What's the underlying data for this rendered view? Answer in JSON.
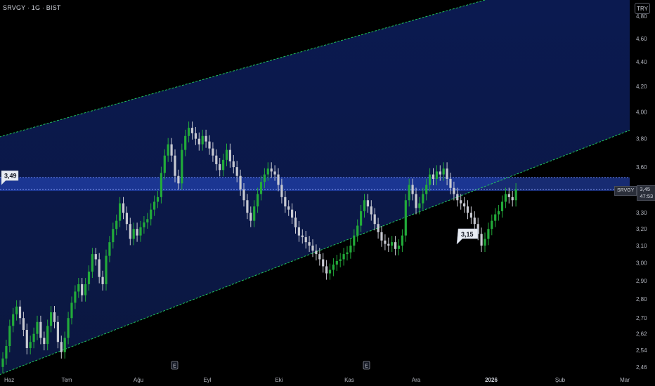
{
  "header": {
    "ticker": "SRVGY · 1G · BIST",
    "currency_button": "TRY"
  },
  "price_tag": {
    "symbol": "SRVGY",
    "price": "3,45",
    "countdown": "47:53"
  },
  "callouts": [
    {
      "label": "3,49",
      "value": 3.49,
      "anchor": "left-edge"
    },
    {
      "label": "3,15",
      "value": 3.15,
      "anchor": "mid-right"
    }
  ],
  "earnings_markers": [
    "E",
    "E"
  ],
  "colors": {
    "up": "#089981",
    "up_bright": "#22ab3a",
    "down": "#c7c9d1",
    "channel_line": "#22c55e",
    "band": "#2a4fd0",
    "background": "#000000"
  },
  "chart_data": {
    "type": "candlestick",
    "title": "",
    "y_scale": "log",
    "ylim": [
      2.43,
      4.95
    ],
    "y_ticks": [
      "4,80",
      "4,60",
      "4,40",
      "4,20",
      "4,00",
      "3,80",
      "3,60",
      "3,30",
      "3,20",
      "3,10",
      "3,00",
      "2,90",
      "2,80",
      "2,70",
      "2,62",
      "2,54",
      "2,46"
    ],
    "y_tick_values": [
      4.8,
      4.6,
      4.4,
      4.2,
      4.0,
      3.8,
      3.6,
      3.3,
      3.2,
      3.1,
      3.0,
      2.9,
      2.8,
      2.7,
      2.62,
      2.54,
      2.46
    ],
    "x_ticks": [
      "Haz",
      "Tem",
      "Ağu",
      "Eyl",
      "Eki",
      "Kas",
      "Ara",
      "2026",
      "Şub",
      "Mar"
    ],
    "grid": false,
    "resistance_band": [
      3.44,
      3.53
    ],
    "last_price": 3.45,
    "channel": {
      "upper": [
        [
          0,
          3.82
        ],
        [
          140,
          4.95
        ]
      ],
      "lower": [
        [
          0,
          2.43
        ],
        [
          140,
          3.47
        ]
      ]
    },
    "closes": [
      2.5,
      2.56,
      2.66,
      2.72,
      2.76,
      2.7,
      2.64,
      2.55,
      2.58,
      2.62,
      2.68,
      2.6,
      2.57,
      2.66,
      2.73,
      2.68,
      2.58,
      2.53,
      2.6,
      2.7,
      2.78,
      2.84,
      2.88,
      2.82,
      2.88,
      2.95,
      3.05,
      3.02,
      2.92,
      2.88,
      3.04,
      3.12,
      3.2,
      3.25,
      3.36,
      3.3,
      3.23,
      3.14,
      3.2,
      3.16,
      3.21,
      3.24,
      3.26,
      3.32,
      3.37,
      3.4,
      3.56,
      3.68,
      3.76,
      3.68,
      3.54,
      3.49,
      3.72,
      3.82,
      3.88,
      3.84,
      3.8,
      3.76,
      3.82,
      3.78,
      3.73,
      3.68,
      3.62,
      3.58,
      3.65,
      3.72,
      3.64,
      3.6,
      3.54,
      3.45,
      3.38,
      3.3,
      3.25,
      3.34,
      3.42,
      3.5,
      3.55,
      3.59,
      3.57,
      3.55,
      3.48,
      3.4,
      3.34,
      3.32,
      3.27,
      3.21,
      3.16,
      3.15,
      3.12,
      3.1,
      3.07,
      3.05,
      3.02,
      2.98,
      2.94,
      2.96,
      2.99,
      3.01,
      3.02,
      3.05,
      3.06,
      3.1,
      3.16,
      3.22,
      3.31,
      3.38,
      3.34,
      3.29,
      3.23,
      3.18,
      3.13,
      3.11,
      3.1,
      3.12,
      3.08,
      3.1,
      3.16,
      3.38,
      3.48,
      3.42,
      3.33,
      3.36,
      3.42,
      3.48,
      3.55,
      3.52,
      3.57,
      3.55,
      3.59,
      3.52,
      3.46,
      3.42,
      3.38,
      3.36,
      3.34,
      3.3,
      3.27,
      3.23,
      3.17,
      3.1,
      3.14,
      3.2,
      3.25,
      3.29,
      3.31,
      3.37,
      3.42,
      3.4,
      3.38,
      3.45
    ],
    "opens": [
      2.46,
      2.5,
      2.56,
      2.66,
      2.72,
      2.76,
      2.7,
      2.64,
      2.55,
      2.58,
      2.62,
      2.68,
      2.6,
      2.57,
      2.66,
      2.73,
      2.68,
      2.58,
      2.53,
      2.6,
      2.7,
      2.78,
      2.84,
      2.88,
      2.82,
      2.88,
      2.95,
      3.05,
      3.02,
      2.92,
      2.88,
      3.04,
      3.12,
      3.2,
      3.25,
      3.36,
      3.3,
      3.23,
      3.14,
      3.2,
      3.16,
      3.21,
      3.24,
      3.26,
      3.32,
      3.37,
      3.4,
      3.56,
      3.68,
      3.76,
      3.68,
      3.54,
      3.49,
      3.72,
      3.82,
      3.88,
      3.84,
      3.8,
      3.76,
      3.82,
      3.78,
      3.73,
      3.68,
      3.62,
      3.58,
      3.65,
      3.72,
      3.64,
      3.6,
      3.54,
      3.45,
      3.38,
      3.3,
      3.25,
      3.34,
      3.42,
      3.5,
      3.55,
      3.59,
      3.57,
      3.55,
      3.48,
      3.4,
      3.34,
      3.32,
      3.27,
      3.21,
      3.16,
      3.15,
      3.12,
      3.1,
      3.07,
      3.05,
      3.02,
      2.98,
      2.94,
      2.96,
      2.99,
      3.01,
      3.02,
      3.05,
      3.06,
      3.1,
      3.16,
      3.22,
      3.31,
      3.38,
      3.34,
      3.29,
      3.23,
      3.18,
      3.13,
      3.11,
      3.1,
      3.12,
      3.08,
      3.1,
      3.16,
      3.38,
      3.48,
      3.42,
      3.33,
      3.36,
      3.42,
      3.48,
      3.55,
      3.52,
      3.57,
      3.55,
      3.59,
      3.52,
      3.46,
      3.42,
      3.38,
      3.36,
      3.34,
      3.3,
      3.27,
      3.23,
      3.17,
      3.1,
      3.14,
      3.2,
      3.25,
      3.29,
      3.31,
      3.37,
      3.42,
      3.4,
      3.38
    ]
  }
}
